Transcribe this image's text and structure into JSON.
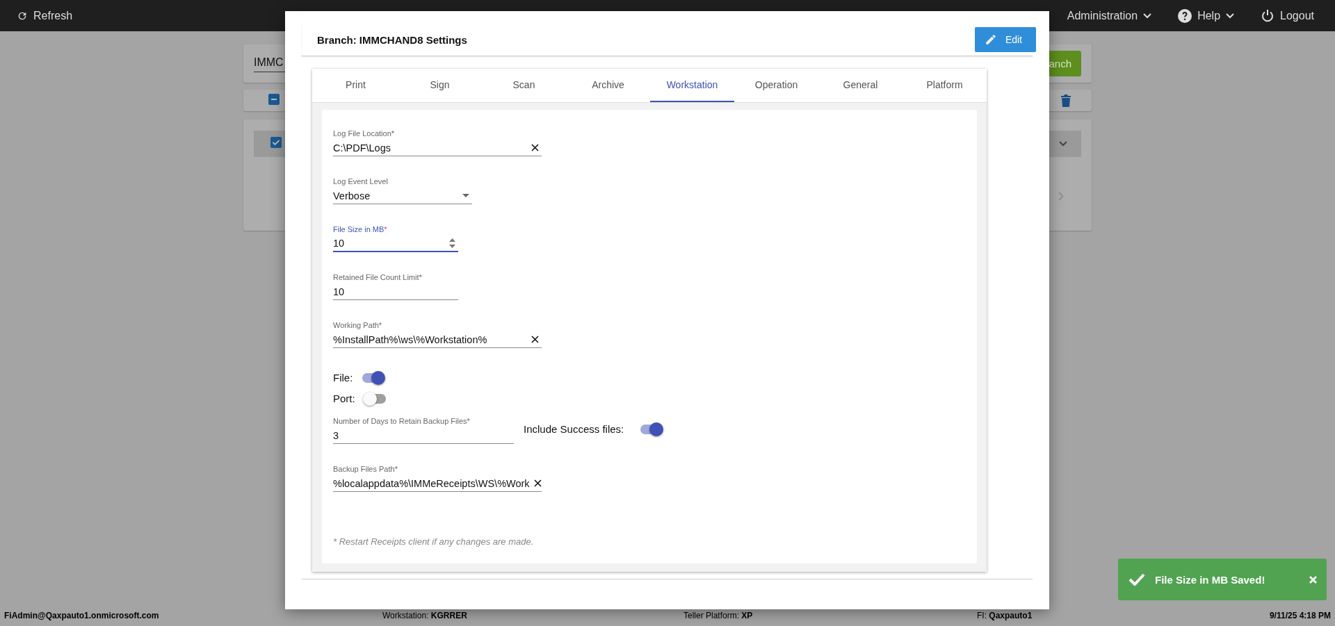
{
  "top_bar": {
    "refresh": "Refresh",
    "menus": [
      {
        "label": "Administration",
        "kind": "dropdown"
      },
      {
        "label": "Help",
        "kind": "dropdown"
      },
      {
        "label": "Logout",
        "kind": "button"
      }
    ]
  },
  "background_page": {
    "search": {
      "value": "IMMC"
    },
    "search_button": "anch",
    "select_all": {
      "indeterminate": true
    },
    "rows": [
      {
        "checked": true
      }
    ]
  },
  "modal": {
    "title": "Branch: IMMCHAND8 Settings",
    "edit_button": "Edit",
    "tabs": [
      {
        "label": "Print",
        "selected": false
      },
      {
        "label": "Sign",
        "selected": false
      },
      {
        "label": "Scan",
        "selected": false
      },
      {
        "label": "Archive",
        "selected": false
      },
      {
        "label": "Workstation",
        "selected": true
      },
      {
        "label": "Operation",
        "selected": false
      },
      {
        "label": "General",
        "selected": false
      },
      {
        "label": "Platform",
        "selected": false
      }
    ],
    "form": [
      {
        "kind": "text",
        "label": "Log File Location",
        "required_mark": "*",
        "value": "C:\\PDF\\Logs",
        "clearable": true,
        "focused": false
      },
      {
        "kind": "select",
        "label": "Log Event Level",
        "value": "Verbose",
        "focused": false
      },
      {
        "kind": "number",
        "label": "File Size in MB",
        "required_mark": "*",
        "value": "10",
        "focused": true
      },
      {
        "kind": "text",
        "label": "Retained File Count Limit",
        "required_mark": "*",
        "value": "10",
        "clearable": false,
        "focused": false
      },
      {
        "kind": "text",
        "label": "Working Path",
        "required_mark": "*",
        "value": "%InstallPath%\\ws\\%Workstation%",
        "clearable": true,
        "focused": false
      },
      {
        "kind": "toggle",
        "label": "File:",
        "on": true
      },
      {
        "kind": "toggle",
        "label": "Port:",
        "on": false
      },
      {
        "kind": "row",
        "items": [
          {
            "kind": "text",
            "label": "Number of Days to Retain Backup Files",
            "required_mark": "*",
            "value": "3",
            "clearable": false,
            "focused": false
          },
          {
            "kind": "toggle",
            "label": "Include Success files:",
            "on": true
          }
        ]
      },
      {
        "kind": "text",
        "label": "Backup Files Path",
        "required_mark": "*",
        "value": "%localappdata%\\IMMeReceipts\\WS\\%Work",
        "clearable": true,
        "focused": false
      }
    ],
    "note": "* Restart Receipts client if any changes are made."
  },
  "toast": {
    "message": "File Size in MB Saved!"
  },
  "status_bar": {
    "user": "FiAdmin@Qaxpauto1.onmicrosoft.com",
    "workstation": "Workstation: **KGRRER**",
    "platform": "Teller Platform: **XP**",
    "fi": "FI: **Qaxpauto1**",
    "datetime": "9/11/25 4:18 PM"
  }
}
